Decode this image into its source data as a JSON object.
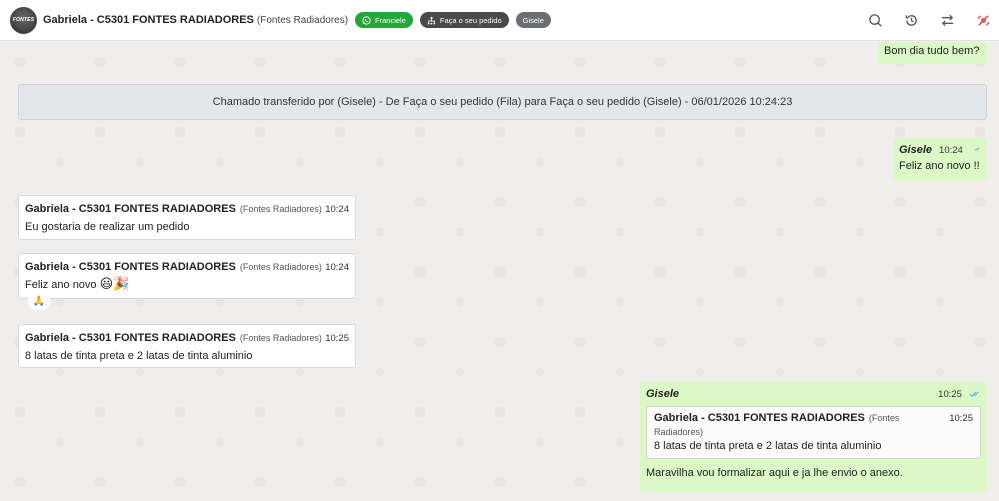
{
  "header": {
    "avatar_text": "FONTES",
    "contact_name": "Gabriela - C5301 FONTES RADIADORES",
    "contact_sub": "(Fontes Radiadores)",
    "tags": [
      {
        "label": "Franciele",
        "color": "#25a53a"
      },
      {
        "label": "Faça o seu pedido",
        "color": "#4a4a4a"
      },
      {
        "label": "Gisele",
        "color": "#6a6f74"
      }
    ],
    "icons": [
      "search-icon",
      "history-icon",
      "transfer-icon",
      "close-ticket-icon"
    ]
  },
  "messages": {
    "m1": {
      "text": "Bom dia tudo bem?"
    },
    "system": {
      "text": "Chamado transferido por (Gisele) - De Faça o seu pedido (Fila) para Faça o seu pedido (Gisele) - 06/01/2026 10:24:23"
    },
    "m2": {
      "sender": "Gisele",
      "time": "10:24",
      "text": "Feliz ano novo !!"
    },
    "m3": {
      "sender": "Gabriela - C5301 FONTES RADIADORES",
      "sender_sub": "(Fontes Radiadores)",
      "time": "10:24",
      "text": "Eu gostaria de realizar um pedido"
    },
    "m4": {
      "sender": "Gabriela - C5301 FONTES RADIADORES",
      "sender_sub": "(Fontes Radiadores)",
      "time": "10:24",
      "text": "Feliz ano novo",
      "emoji": "😃🎉",
      "reaction": "🙏"
    },
    "m5": {
      "sender": "Gabriela - C5301 FONTES RADIADORES",
      "sender_sub": "(Fontes Radiadores)",
      "time": "10:25",
      "text": "8 latas de tinta preta e 2 latas de tinta aluminio"
    },
    "m6": {
      "sender": "Gisele",
      "time": "10:25",
      "quote": {
        "sender": "Gabriela - C5301 FONTES RADIADORES",
        "sender_sub_1": "(Fontes",
        "sender_sub_2": "Radiadores)",
        "time": "10:25",
        "text": "8 latas de tinta preta e 2 latas de tinta aluminio"
      },
      "text": "Maravilha vou formalizar aqui e ja lhe envio o anexo."
    }
  },
  "colors": {
    "outgoing": "#dcf8c6",
    "incoming": "#ffffff",
    "check": "#4fb6ec"
  }
}
